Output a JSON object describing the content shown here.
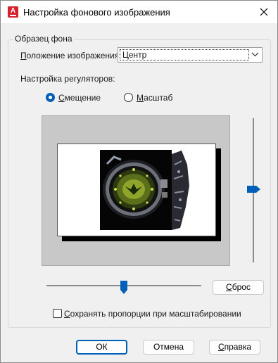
{
  "window": {
    "title": "Настройка фонового изображения",
    "app_icon_letter": "A"
  },
  "group": {
    "label": "Образец фона"
  },
  "position": {
    "label_underlined": "П",
    "label_rest": "оложение изображения:",
    "value": "Центр"
  },
  "sliders_section": {
    "label": "Настройка регуляторов:"
  },
  "mode": {
    "options": [
      {
        "underlined": "С",
        "rest": "мещение",
        "checked": true
      },
      {
        "underlined": "М",
        "rest": "асштаб",
        "checked": false
      }
    ]
  },
  "sliders": {
    "vertical_offset_fraction": 0.5,
    "horizontal_offset_fraction": 0.5
  },
  "buttons": {
    "reset": {
      "underlined": "С",
      "rest": "брос"
    },
    "ok": "ОК",
    "cancel": "Отмена",
    "help": {
      "underlined": "С",
      "rest": "правка"
    }
  },
  "keep_aspect": {
    "underlined": "С",
    "rest": "охранять пропорции при масштабировании",
    "checked": false
  },
  "colors": {
    "accent": "#005fb8",
    "app_icon": "#d6222c",
    "preview_bg": "#c8c8c8"
  }
}
